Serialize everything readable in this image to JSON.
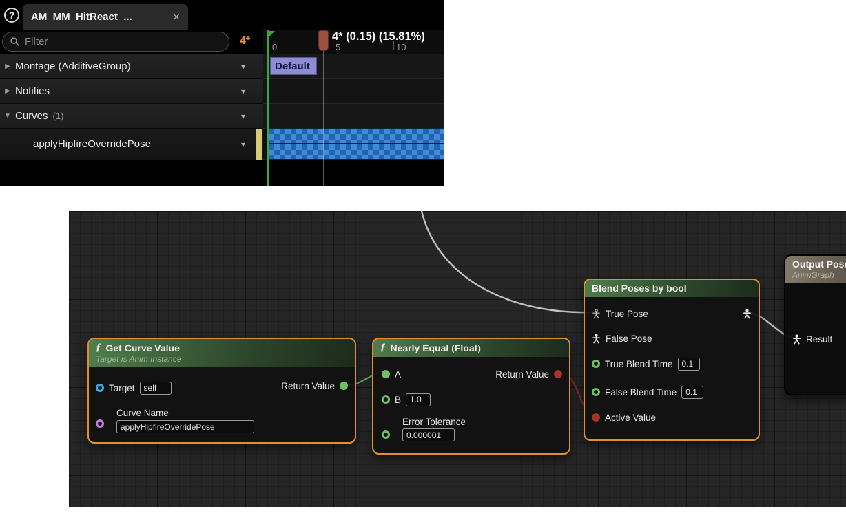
{
  "colors": {
    "selection_orange": "#E0912E",
    "filter_badge_orange": "#E8932F",
    "curve_strip_blue_light": "#3F8BD8",
    "curve_strip_blue_dark": "#2264AF",
    "timeline_green": "#3DA53D",
    "node_header_green": "#527D4C",
    "pin_float_green": "#6FBF63",
    "pin_bool_red": "#A93226",
    "pin_object_blue": "#3FA7E0",
    "pin_string_magenta": "#C87BD8"
  },
  "montage_panel": {
    "help_glyph": "?",
    "tab": {
      "title": "AM_MM_HitReact_...",
      "close_label": "×"
    },
    "filter": {
      "placeholder": "Filter",
      "badge": "4*"
    },
    "rows": [
      {
        "label": "Montage (AdditiveGroup)",
        "expander": "▶",
        "dropdown": "▾"
      },
      {
        "label": "Notifies",
        "expander": "▶",
        "dropdown": "▾"
      },
      {
        "label": "Curves",
        "count": "(1)",
        "expander": "▼",
        "dropdown": "▾"
      },
      {
        "label": "applyHipfireOverridePose",
        "dropdown": "▾"
      }
    ],
    "timeline": {
      "playhead_readout": "4* (0.15) (15.81%)",
      "ticks": [
        "0",
        "5",
        "10"
      ],
      "section_label": "Default"
    }
  },
  "graph": {
    "get_curve_value": {
      "title": "Get Curve Value",
      "subtitle": "Target is Anim Instance",
      "fn_glyph": "ƒ",
      "target_label": "Target",
      "target_value": "self",
      "curve_name_label": "Curve Name",
      "curve_name_value": "applyHipfireOverridePose",
      "return_label": "Return Value"
    },
    "nearly_equal": {
      "title": "Nearly Equal (Float)",
      "fn_glyph": "ƒ",
      "a_label": "A",
      "b_label": "B",
      "b_value": "1.0",
      "tolerance_label": "Error Tolerance",
      "tolerance_value": "0.000001",
      "return_label": "Return Value"
    },
    "blend_poses": {
      "title": "Blend Poses by bool",
      "true_pose_label": "True Pose",
      "false_pose_label": "False Pose",
      "true_blend_label": "True Blend Time",
      "true_blend_value": "0.1",
      "false_blend_label": "False Blend Time",
      "false_blend_value": "0.1",
      "active_value_label": "Active Value"
    },
    "output_pose": {
      "title": "Output Pose",
      "subtitle": "AnimGraph",
      "result_label": "Result"
    }
  }
}
